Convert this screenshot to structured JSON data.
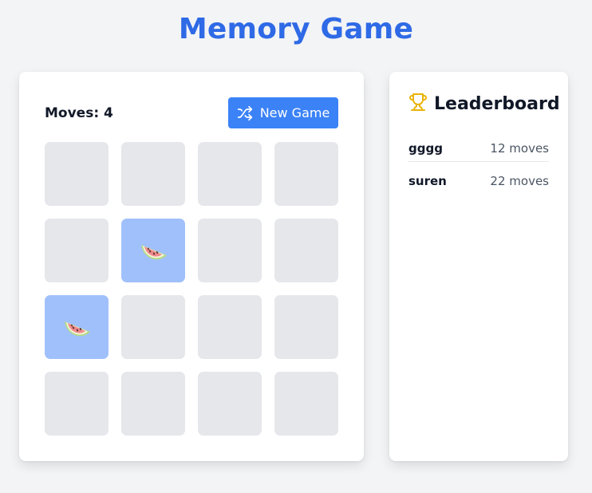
{
  "header": {
    "title": "Memory Game"
  },
  "game": {
    "moves_label": "Moves: 4",
    "new_game_label": "New Game",
    "cards": [
      {
        "state": "hidden"
      },
      {
        "state": "hidden"
      },
      {
        "state": "hidden"
      },
      {
        "state": "hidden"
      },
      {
        "state": "hidden"
      },
      {
        "state": "flipped",
        "icon": "watermelon-icon"
      },
      {
        "state": "hidden"
      },
      {
        "state": "hidden"
      },
      {
        "state": "flipped",
        "icon": "watermelon-icon"
      },
      {
        "state": "hidden"
      },
      {
        "state": "hidden"
      },
      {
        "state": "hidden"
      },
      {
        "state": "hidden"
      },
      {
        "state": "hidden"
      },
      {
        "state": "hidden"
      },
      {
        "state": "hidden"
      }
    ]
  },
  "leaderboard": {
    "title": "Leaderboard",
    "icon": "trophy-icon",
    "entries": [
      {
        "name": "gggg",
        "score": "12 moves"
      },
      {
        "name": "suren",
        "score": "22 moves"
      }
    ]
  },
  "colors": {
    "accent": "#3b82f6",
    "title": "#2f6ae6",
    "card_hidden": "#e5e7eb",
    "card_flipped": "#a0c0fb",
    "trophy": "#eab308"
  }
}
